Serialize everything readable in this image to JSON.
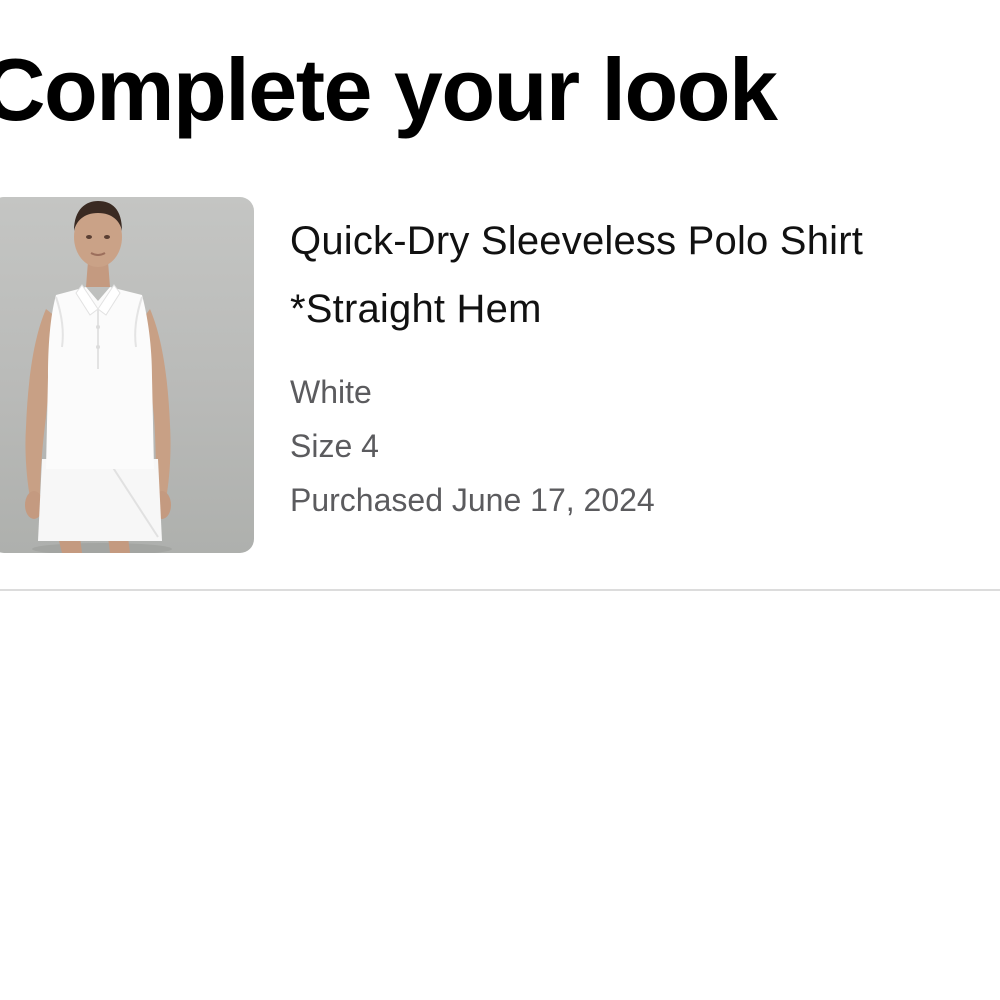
{
  "section": {
    "title": "Complete your look"
  },
  "product": {
    "name_line1": "Quick-Dry Sleeveless Polo Shirt",
    "name_line2": "*Straight Hem",
    "color": "White",
    "size": "Size 4",
    "purchased": "Purchased June 17, 2024",
    "image_icon": "product-photo"
  },
  "colors": {
    "title": "#000000",
    "meta_text": "#5b5b5e",
    "divider": "#dcdcdc",
    "image_bg": "#bdbebc"
  }
}
